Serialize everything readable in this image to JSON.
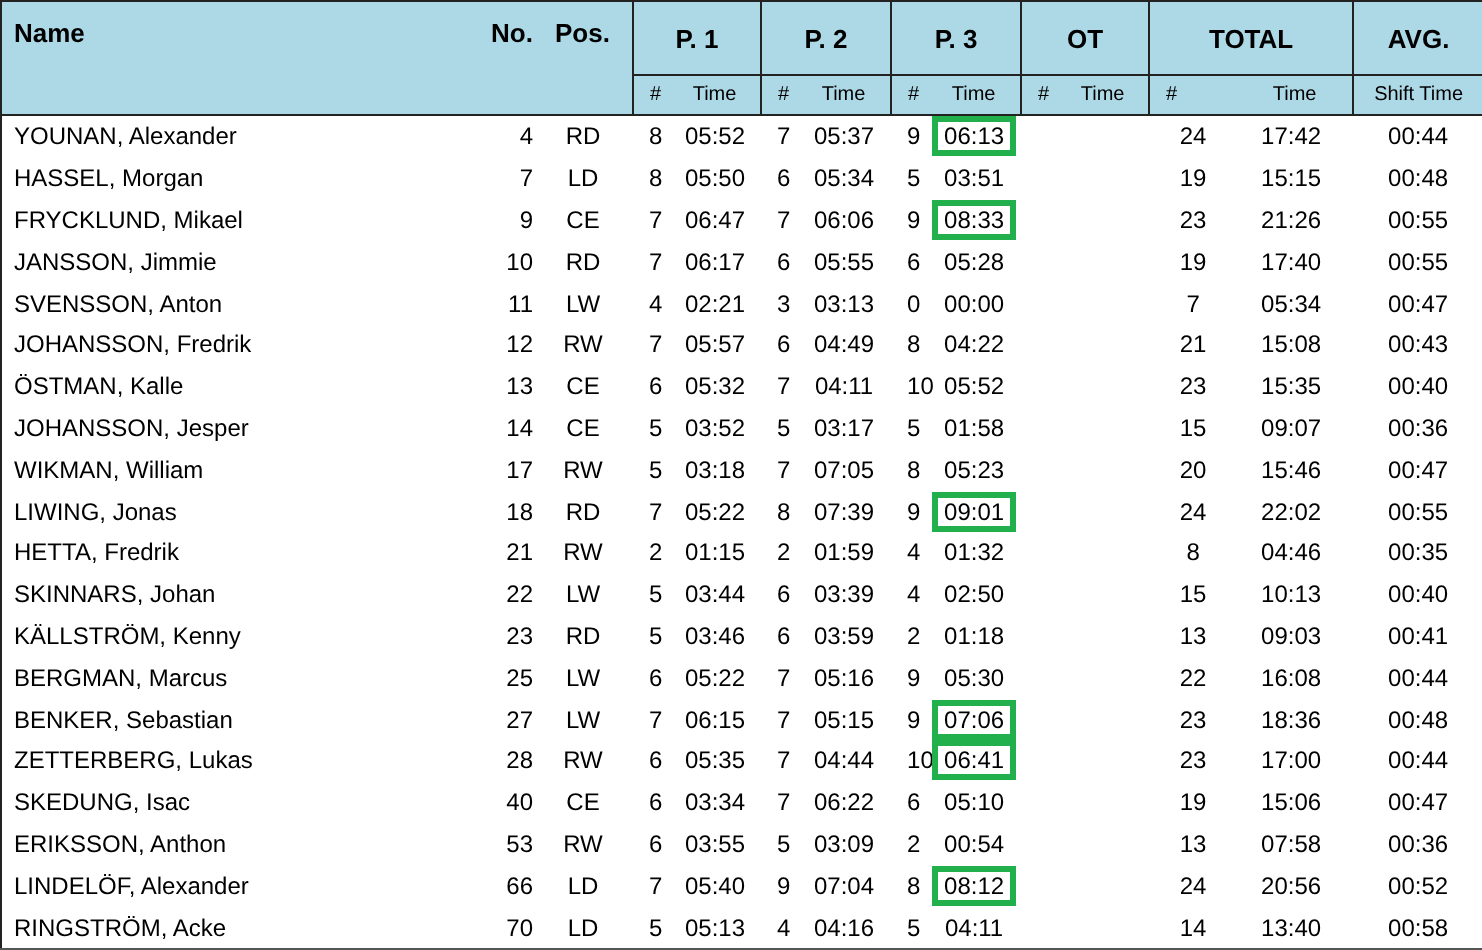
{
  "columns": {
    "name": "Name",
    "number": "No.",
    "position": "Pos.",
    "groups": [
      {
        "label": "P. 1",
        "sub": [
          "#",
          "Time"
        ]
      },
      {
        "label": "P. 2",
        "sub": [
          "#",
          "Time"
        ]
      },
      {
        "label": "P. 3",
        "sub": [
          "#",
          "Time"
        ]
      },
      {
        "label": "OT",
        "sub": [
          "#",
          "Time"
        ]
      },
      {
        "label": "TOTAL",
        "sub": [
          "#",
          "Time"
        ]
      },
      {
        "label": "AVG.",
        "sub": [
          "Shift Time"
        ]
      }
    ]
  },
  "rows": [
    {
      "name": "YOUNAN, Alexander",
      "number": "4",
      "position": "RD",
      "p1": [
        "8",
        "05:52"
      ],
      "p2": [
        "7",
        "05:37"
      ],
      "p3": [
        "9",
        "06:13"
      ],
      "p3_highlighted": true,
      "total": [
        "24",
        "17:42"
      ],
      "avg": "00:44"
    },
    {
      "name": "HASSEL, Morgan",
      "number": "7",
      "position": "LD",
      "p1": [
        "8",
        "05:50"
      ],
      "p2": [
        "6",
        "05:34"
      ],
      "p3": [
        "5",
        "03:51"
      ],
      "p3_highlighted": false,
      "total": [
        "19",
        "15:15"
      ],
      "avg": "00:48"
    },
    {
      "name": "FRYCKLUND, Mikael",
      "number": "9",
      "position": "CE",
      "p1": [
        "7",
        "06:47"
      ],
      "p2": [
        "7",
        "06:06"
      ],
      "p3": [
        "9",
        "08:33"
      ],
      "p3_highlighted": true,
      "total": [
        "23",
        "21:26"
      ],
      "avg": "00:55"
    },
    {
      "name": "JANSSON, Jimmie",
      "number": "10",
      "position": "RD",
      "p1": [
        "7",
        "06:17"
      ],
      "p2": [
        "6",
        "05:55"
      ],
      "p3": [
        "6",
        "05:28"
      ],
      "p3_highlighted": false,
      "total": [
        "19",
        "17:40"
      ],
      "avg": "00:55"
    },
    {
      "name": "SVENSSON, Anton",
      "number": "11",
      "position": "LW",
      "p1": [
        "4",
        "02:21"
      ],
      "p2": [
        "3",
        "03:13"
      ],
      "p3": [
        "0",
        "00:00"
      ],
      "p3_highlighted": false,
      "total": [
        "7",
        "05:34"
      ],
      "avg": "00:47"
    },
    {
      "name": "JOHANSSON, Fredrik",
      "number": "12",
      "position": "RW",
      "p1": [
        "7",
        "05:57"
      ],
      "p2": [
        "6",
        "04:49"
      ],
      "p3": [
        "8",
        "04:22"
      ],
      "p3_highlighted": false,
      "total": [
        "21",
        "15:08"
      ],
      "avg": "00:43"
    },
    {
      "name": "ÖSTMAN, Kalle",
      "number": "13",
      "position": "CE",
      "p1": [
        "6",
        "05:32"
      ],
      "p2": [
        "7",
        "04:11"
      ],
      "p3": [
        "10",
        "05:52"
      ],
      "p3_highlighted": false,
      "total": [
        "23",
        "15:35"
      ],
      "avg": "00:40"
    },
    {
      "name": "JOHANSSON, Jesper",
      "number": "14",
      "position": "CE",
      "p1": [
        "5",
        "03:52"
      ],
      "p2": [
        "5",
        "03:17"
      ],
      "p3": [
        "5",
        "01:58"
      ],
      "p3_highlighted": false,
      "total": [
        "15",
        "09:07"
      ],
      "avg": "00:36"
    },
    {
      "name": "WIKMAN, William",
      "number": "17",
      "position": "RW",
      "p1": [
        "5",
        "03:18"
      ],
      "p2": [
        "7",
        "07:05"
      ],
      "p3": [
        "8",
        "05:23"
      ],
      "p3_highlighted": false,
      "total": [
        "20",
        "15:46"
      ],
      "avg": "00:47"
    },
    {
      "name": "LIWING, Jonas",
      "number": "18",
      "position": "RD",
      "p1": [
        "7",
        "05:22"
      ],
      "p2": [
        "8",
        "07:39"
      ],
      "p3": [
        "9",
        "09:01"
      ],
      "p3_highlighted": true,
      "total": [
        "24",
        "22:02"
      ],
      "avg": "00:55"
    },
    {
      "name": "HETTA, Fredrik",
      "number": "21",
      "position": "RW",
      "p1": [
        "2",
        "01:15"
      ],
      "p2": [
        "2",
        "01:59"
      ],
      "p3": [
        "4",
        "01:32"
      ],
      "p3_highlighted": false,
      "total": [
        "8",
        "04:46"
      ],
      "avg": "00:35"
    },
    {
      "name": "SKINNARS, Johan",
      "number": "22",
      "position": "LW",
      "p1": [
        "5",
        "03:44"
      ],
      "p2": [
        "6",
        "03:39"
      ],
      "p3": [
        "4",
        "02:50"
      ],
      "p3_highlighted": false,
      "total": [
        "15",
        "10:13"
      ],
      "avg": "00:40"
    },
    {
      "name": "KÄLLSTRÖM, Kenny",
      "number": "23",
      "position": "RD",
      "p1": [
        "5",
        "03:46"
      ],
      "p2": [
        "6",
        "03:59"
      ],
      "p3": [
        "2",
        "01:18"
      ],
      "p3_highlighted": false,
      "total": [
        "13",
        "09:03"
      ],
      "avg": "00:41"
    },
    {
      "name": "BERGMAN, Marcus",
      "number": "25",
      "position": "LW",
      "p1": [
        "6",
        "05:22"
      ],
      "p2": [
        "7",
        "05:16"
      ],
      "p3": [
        "9",
        "05:30"
      ],
      "p3_highlighted": false,
      "total": [
        "22",
        "16:08"
      ],
      "avg": "00:44"
    },
    {
      "name": "BENKER, Sebastian",
      "number": "27",
      "position": "LW",
      "p1": [
        "7",
        "06:15"
      ],
      "p2": [
        "7",
        "05:15"
      ],
      "p3": [
        "9",
        "07:06"
      ],
      "p3_highlighted": true,
      "total": [
        "23",
        "18:36"
      ],
      "avg": "00:48"
    },
    {
      "name": "ZETTERBERG, Lukas",
      "number": "28",
      "position": "RW",
      "p1": [
        "6",
        "05:35"
      ],
      "p2": [
        "7",
        "04:44"
      ],
      "p3": [
        "10",
        "06:41"
      ],
      "p3_highlighted": true,
      "total": [
        "23",
        "17:00"
      ],
      "avg": "00:44"
    },
    {
      "name": "SKEDUNG, Isac",
      "number": "40",
      "position": "CE",
      "p1": [
        "6",
        "03:34"
      ],
      "p2": [
        "7",
        "06:22"
      ],
      "p3": [
        "6",
        "05:10"
      ],
      "p3_highlighted": false,
      "total": [
        "19",
        "15:06"
      ],
      "avg": "00:47"
    },
    {
      "name": "ERIKSSON, Anthon",
      "number": "53",
      "position": "RW",
      "p1": [
        "6",
        "03:55"
      ],
      "p2": [
        "5",
        "03:09"
      ],
      "p3": [
        "2",
        "00:54"
      ],
      "p3_highlighted": false,
      "total": [
        "13",
        "07:58"
      ],
      "avg": "00:36"
    },
    {
      "name": "LINDELÖF, Alexander",
      "number": "66",
      "position": "LD",
      "p1": [
        "7",
        "05:40"
      ],
      "p2": [
        "9",
        "07:04"
      ],
      "p3": [
        "8",
        "08:12"
      ],
      "p3_highlighted": true,
      "total": [
        "24",
        "20:56"
      ],
      "avg": "00:52"
    },
    {
      "name": "RINGSTRÖM, Acke",
      "number": "70",
      "position": "LD",
      "p1": [
        "5",
        "05:13"
      ],
      "p2": [
        "4",
        "04:16"
      ],
      "p3": [
        "5",
        "04:11"
      ],
      "p3_highlighted": false,
      "total": [
        "14",
        "13:40"
      ],
      "avg": "00:58"
    }
  ]
}
